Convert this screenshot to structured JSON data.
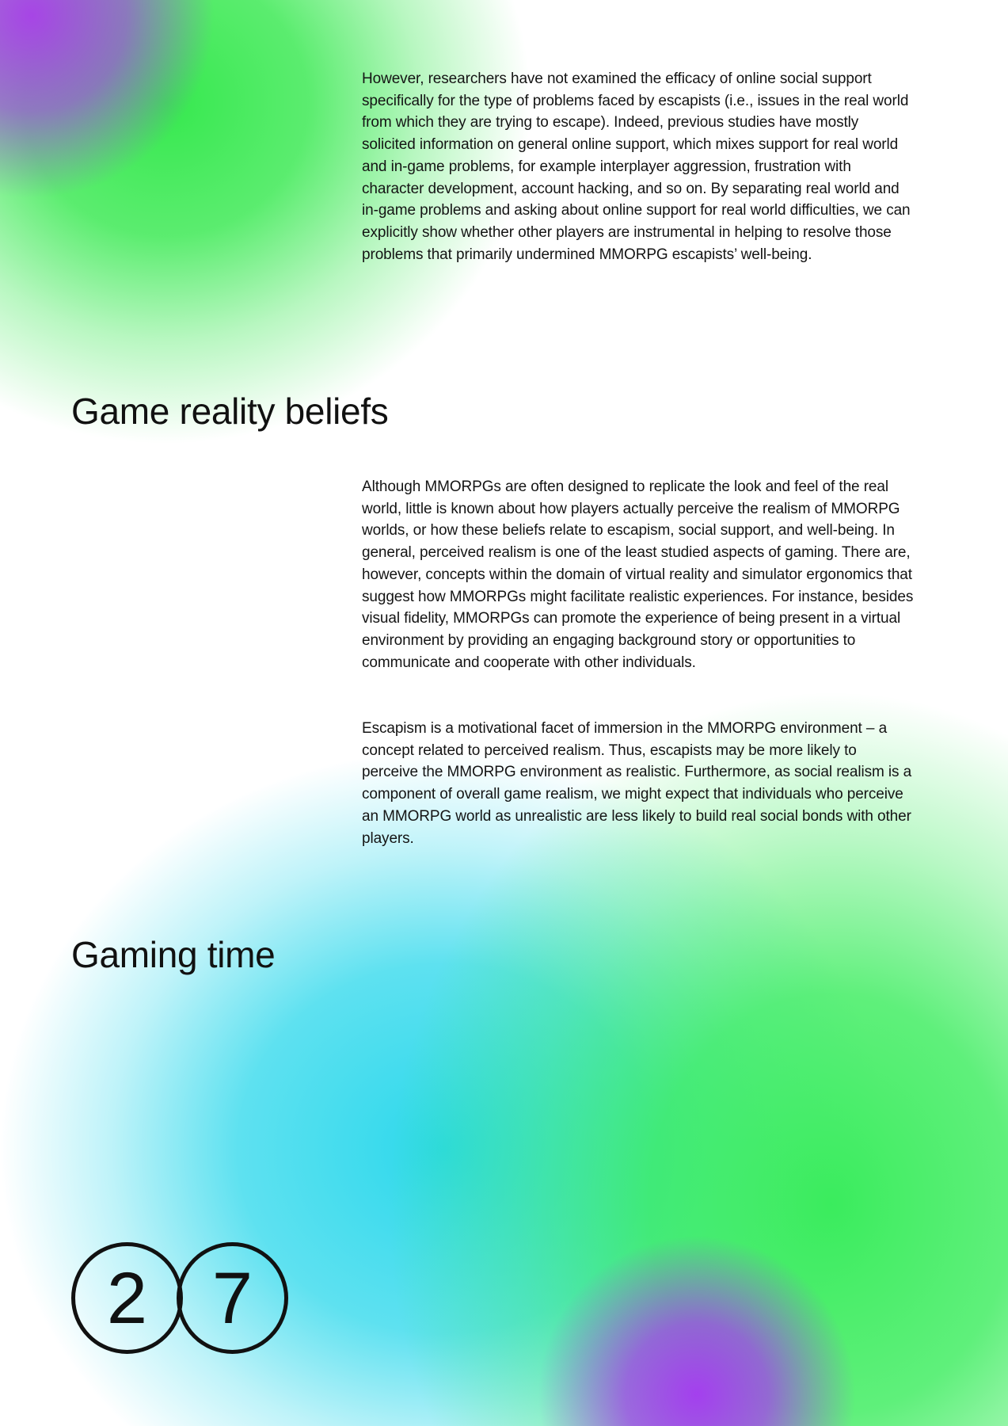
{
  "sections": {
    "intro_paragraph": "However, researchers have not examined the efficacy of online social support specifically for the type of problems faced by escapists (i.e., issues in the real world from which they are trying to escape). Indeed, previous studies have mostly solicited information on general online support, which mixes support for real world and in-game problems, for example interplayer aggression, frustration with character development, account hacking, and so on. By separating real world and in-game problems and asking about online support for real world difficulties, we can explicitly show whether other players are instrumental in helping to resolve those problems that primarily undermined MMORPG escapists’ well-being.",
    "game_reality": {
      "heading": "Game reality beliefs",
      "paragraph1": "Although MMORPGs are often designed to replicate the look and feel of the real world, little is known about how players actually perceive the realism of MMORPG worlds, or how these beliefs relate to escapism, social support, and well-being. In general, perceived realism is one of the least studied aspects of gaming. There are, however, concepts within the domain of virtual reality and simulator ergonomics that suggest how MMORPGs might facilitate realistic experiences. For instance, besides visual fidelity, MMORPGs can promote the experience of being present in a virtual environment by providing an engaging background story or opportunities to communicate and cooperate with other individuals.",
      "paragraph2": "Escapism is a motivational facet of immersion in the MMORPG environment – a concept related to perceived realism. Thus, escapists may be more likely to perceive the MMORPG environment as realistic. Furthermore, as social realism is a component of overall game realism, we might expect that individuals who perceive an MMORPG world as unrealistic are less likely to build real social bonds with other players."
    },
    "gaming_time": {
      "heading": "Gaming time"
    }
  },
  "page_number": {
    "digit1": "2",
    "digit2": "7"
  },
  "colors": {
    "green": "#32e84b",
    "purple": "#a63cf0",
    "cyan": "#28d7eb",
    "text": "#111111"
  }
}
